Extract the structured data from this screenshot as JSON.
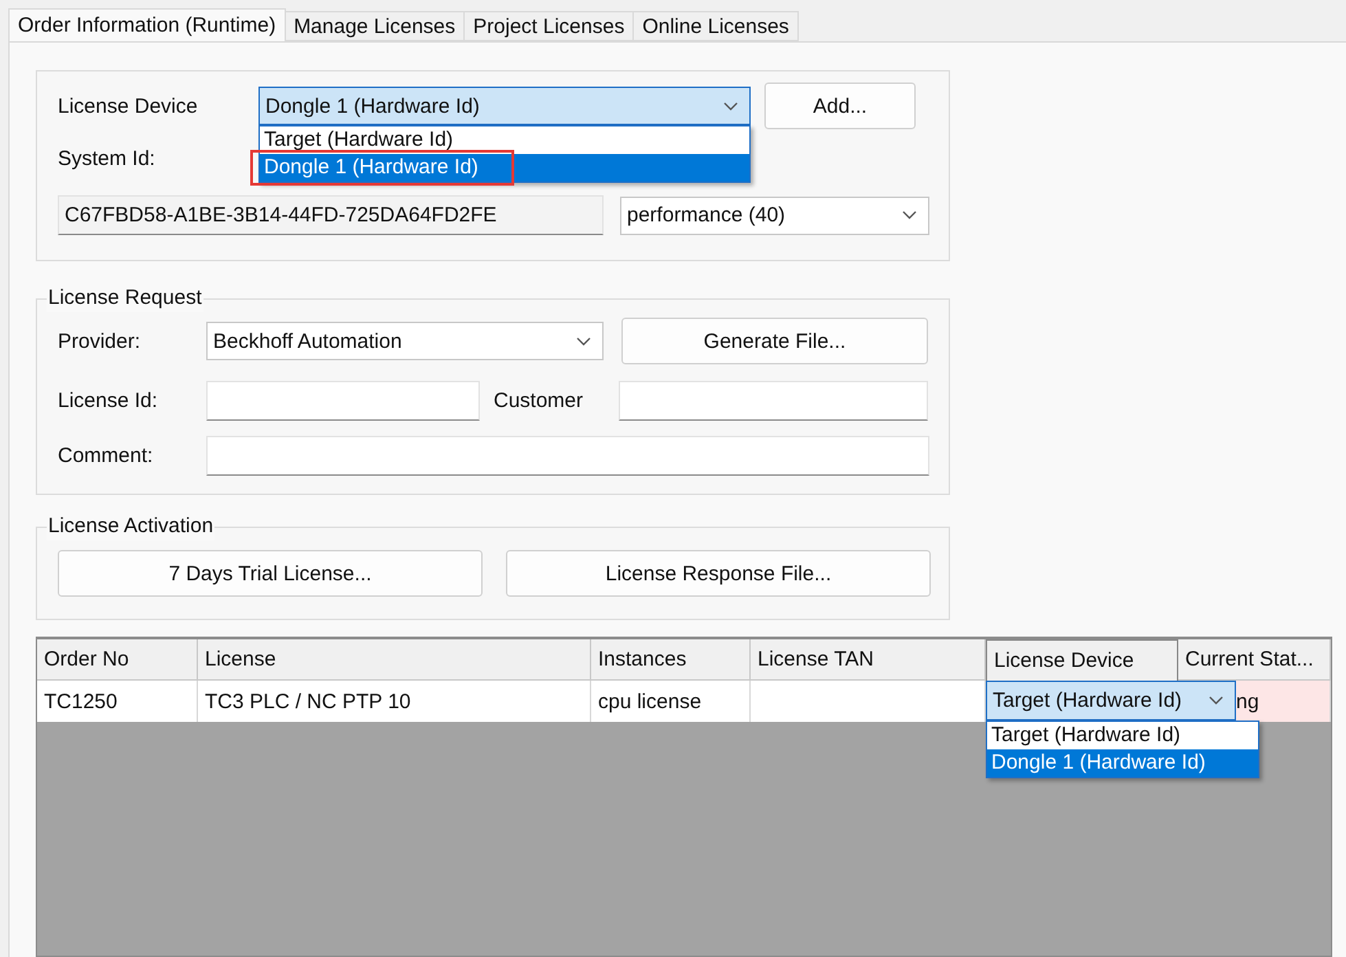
{
  "tabs": [
    {
      "label": "Order Information (Runtime)",
      "selected": true
    },
    {
      "label": "Manage Licenses",
      "selected": false
    },
    {
      "label": "Project Licenses",
      "selected": false
    },
    {
      "label": "Online Licenses",
      "selected": false
    }
  ],
  "device_group": {
    "device_label": "License Device",
    "device_select": {
      "value": "Dongle 1 (Hardware Id)",
      "open": true,
      "options": [
        {
          "label": "Target (Hardware Id)",
          "hovered": false,
          "annotated": false
        },
        {
          "label": "Dongle 1 (Hardware Id)",
          "hovered": true,
          "annotated": true
        }
      ]
    },
    "add_button": "Add...",
    "system_id_label": "System Id:",
    "system_id": "C67FBD58-A1BE-3B14-44FD-725DA64FD2FE",
    "performance_select": "performance (40)"
  },
  "license_request": {
    "title": "License Request",
    "provider_label": "Provider:",
    "provider": "Beckhoff Automation",
    "generate_button": "Generate File...",
    "license_id_label": "License Id:",
    "customer_label": "Customer",
    "comment_label": "Comment:"
  },
  "license_activation": {
    "title": "License Activation",
    "buttons": [
      "7 Days Trial License...",
      "License Response File..."
    ]
  },
  "table": {
    "columns": [
      "Order No",
      "License",
      "Instances",
      "License TAN",
      "License Device",
      "Current Stat..."
    ],
    "rows": [
      {
        "order_no": "TC1250",
        "license": "TC3 PLC / NC PTP 10",
        "instances": "cpu license",
        "device_select": {
          "value": "Target (Hardware Id)",
          "open": true,
          "options": [
            {
              "label": "Target (Hardware Id)",
              "hovered": false
            },
            {
              "label": "Dongle 1 (Hardware Id)",
              "hovered": true
            }
          ]
        },
        "status": "ng",
        "status_alert": true
      }
    ]
  }
}
